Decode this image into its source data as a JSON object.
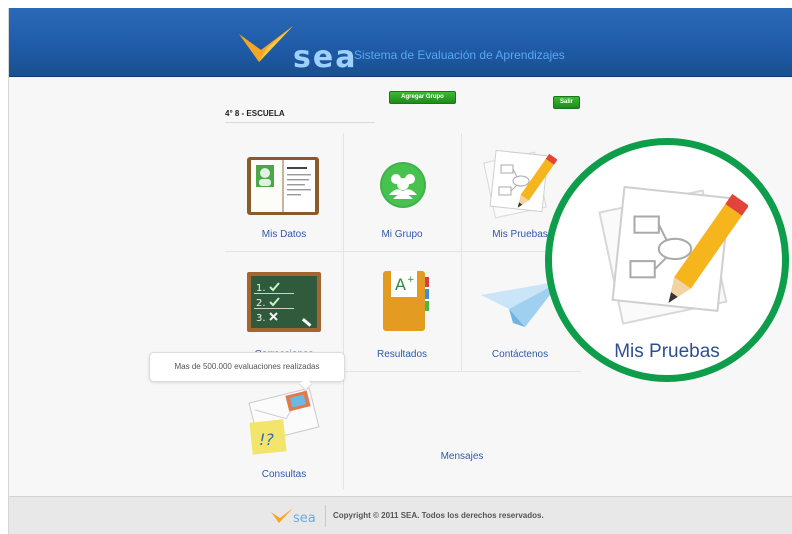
{
  "header": {
    "logo_text": "sea",
    "tagline": "Sistema de Evaluación de Aprendizajes"
  },
  "student": {
    "label": "4° 8 - ESCUELA"
  },
  "buttons": {
    "add_group": "Agregar Grupo",
    "logout": "Salir"
  },
  "tiles": [
    {
      "label": "Mis Datos",
      "icon": "notebook-icon"
    },
    {
      "label": "Mi Grupo",
      "icon": "group-icon"
    },
    {
      "label": "Mis Pruebas",
      "icon": "test-pencil-icon"
    },
    {
      "label": "Correcciones",
      "icon": "chalkboard-icon"
    },
    {
      "label": "Resultados",
      "icon": "grade-folder-icon"
    },
    {
      "label": "Contáctenos",
      "icon": "paper-plane-icon"
    },
    {
      "label": "Consultas",
      "icon": "envelope-note-icon"
    },
    {
      "label": "Mensajes",
      "icon": "speech-bubble"
    }
  ],
  "messages": {
    "bubble_text": "Mas de 500.000 evaluaciones realizadas"
  },
  "zoom": {
    "label": "Mis Pruebas"
  },
  "footer": {
    "logo_text": "sea",
    "copyright": "Copyright © 2011 SEA. Todos los derechos reservados."
  },
  "colors": {
    "header_blue": "#1f5aa6",
    "link_blue": "#2f59a7",
    "button_green": "#2aa128",
    "zoom_ring": "#0d9d4b"
  }
}
